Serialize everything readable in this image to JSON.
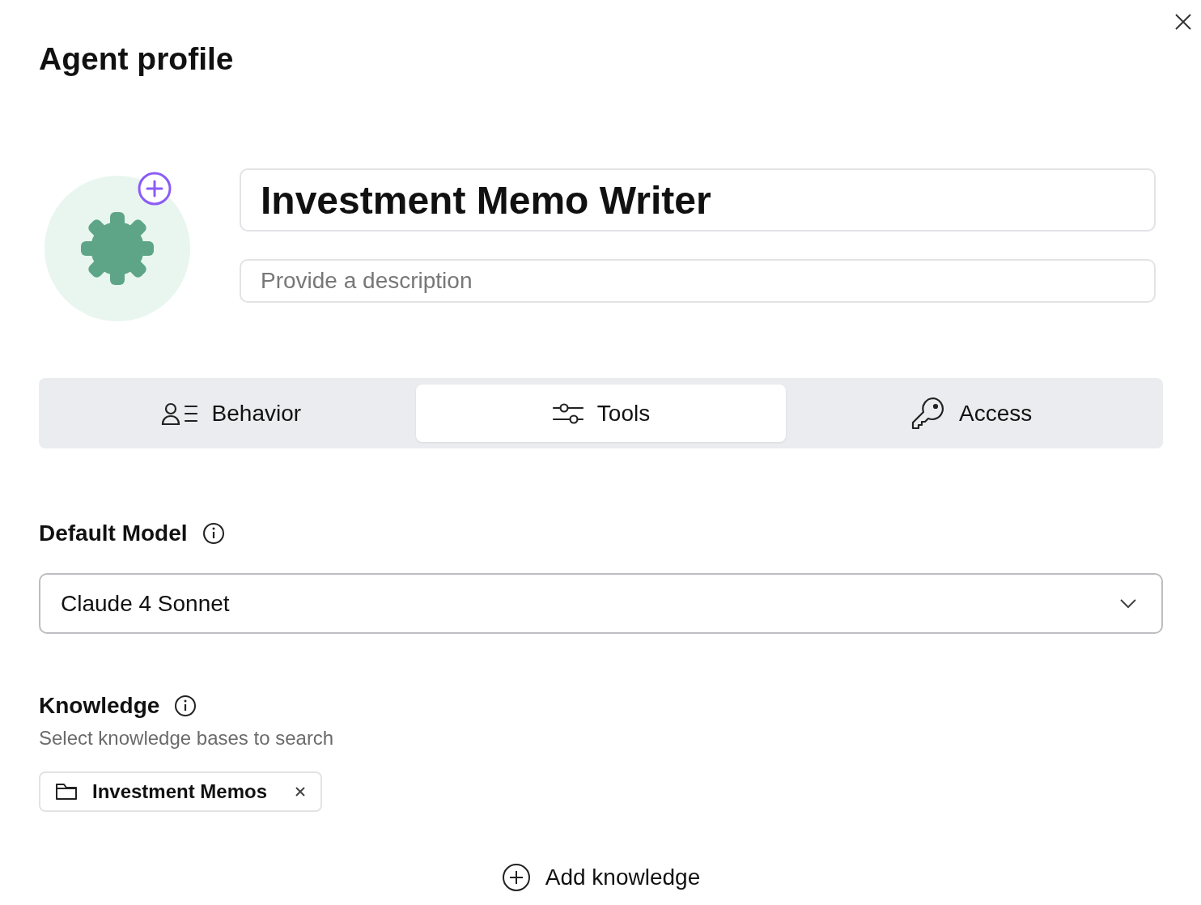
{
  "title": "Agent profile",
  "name_field": {
    "value": "Investment Memo Writer"
  },
  "description_field": {
    "placeholder": "Provide a description"
  },
  "tabs": [
    {
      "label": "Behavior",
      "kind": "behavior",
      "selected": false
    },
    {
      "label": "Tools",
      "kind": "tools",
      "selected": true
    },
    {
      "label": "Access",
      "kind": "access",
      "selected": false
    }
  ],
  "default_model": {
    "label": "Default Model",
    "value": "Claude 4 Sonnet"
  },
  "knowledge": {
    "label": "Knowledge",
    "subtitle": "Select knowledge bases to search",
    "items": [
      {
        "label": "Investment Memos"
      }
    ],
    "add_button": "Add knowledge"
  }
}
